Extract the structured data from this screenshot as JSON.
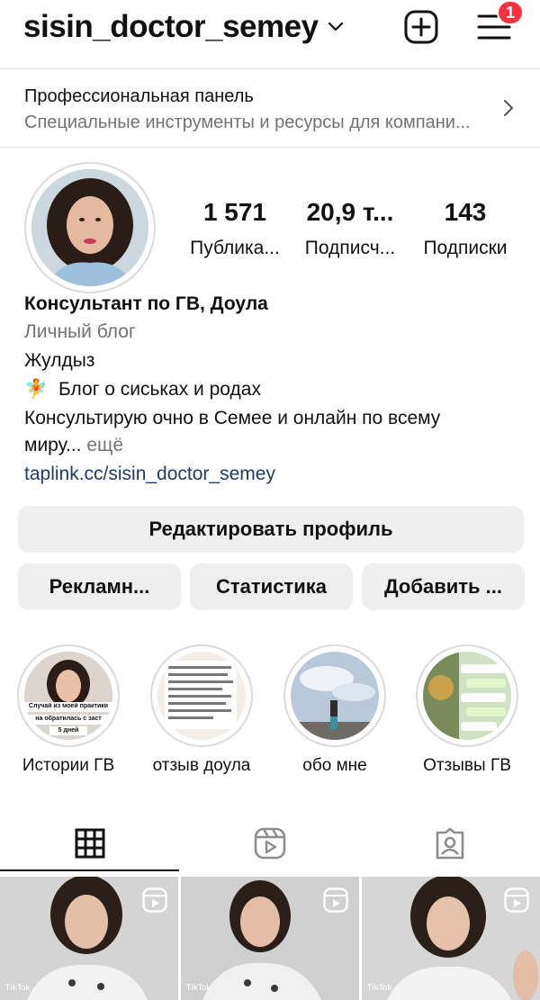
{
  "header": {
    "username": "sisin_doctor_semey",
    "notification_count": "1"
  },
  "pro_panel": {
    "title": "Профессиональная панель",
    "subtitle": "Специальные инструменты и ресурсы для компани..."
  },
  "stats": [
    {
      "value": "1 571",
      "label": "Публика..."
    },
    {
      "value": "20,9 т...",
      "label": "Подписч..."
    },
    {
      "value": "143",
      "label": "Подписки"
    }
  ],
  "bio": {
    "name": "Консультант по ГВ, Доула",
    "category": "Личный блог",
    "line1": "Жулдыз",
    "line2_emoji": "🧚",
    "line2": "Блог о сиськах и родах",
    "line3": "Консультирую очно в Семее и онлайн по всему",
    "line4": "миру...",
    "more": "ещё",
    "link": "taplink.cc/sisin_doctor_semey"
  },
  "buttons": {
    "edit": "Редактировать профиль",
    "ads": "Рекламн...",
    "stats": "Статистика",
    "add": "Добавить ..."
  },
  "highlights": [
    {
      "label": "Истории ГВ",
      "caption1": "Случай из моей практики",
      "caption2": "на обратилась с заст",
      "caption3": "5 дней"
    },
    {
      "label": "отзыв доула"
    },
    {
      "label": "обо мне"
    },
    {
      "label": "Отзывы ГВ"
    }
  ],
  "tabs": [
    "grid-icon",
    "reels-icon",
    "tagged-icon"
  ],
  "posts": [
    {
      "type": "reel",
      "watermark": "TikTok"
    },
    {
      "type": "reel",
      "watermark": "TikTok"
    },
    {
      "type": "reel",
      "watermark": "TikTok"
    }
  ],
  "colors": {
    "badge": "#ff3040",
    "button_bg": "#efefef",
    "link": "#1d3b6b",
    "secondary_text": "#737373"
  }
}
